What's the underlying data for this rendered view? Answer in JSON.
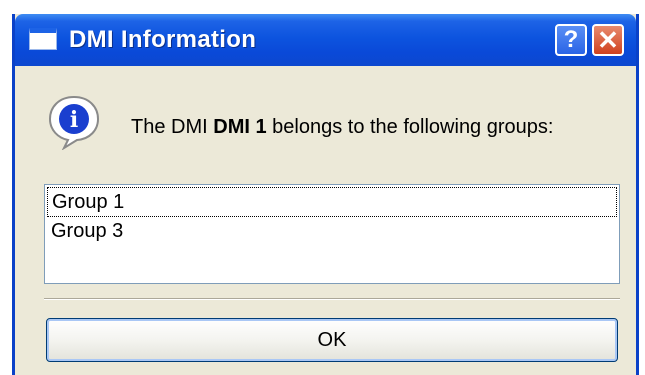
{
  "window": {
    "title": "DMI Information",
    "help_glyph": "?",
    "close_glyph": "✕"
  },
  "message": {
    "prefix": "The DMI ",
    "dmi_name": "DMI 1",
    "suffix": " belongs to the following groups:"
  },
  "groups": [
    {
      "label": "Group 1",
      "focused": true
    },
    {
      "label": "Group 3",
      "focused": false
    }
  ],
  "buttons": {
    "ok_label": "OK"
  },
  "icons": {
    "title": "window-icon",
    "info": "information-icon"
  },
  "colors": {
    "titlebar": "#0a49d8",
    "window_bg": "#ece9d8",
    "close_button": "#d0411f",
    "info_blue": "#1a3fcf"
  }
}
